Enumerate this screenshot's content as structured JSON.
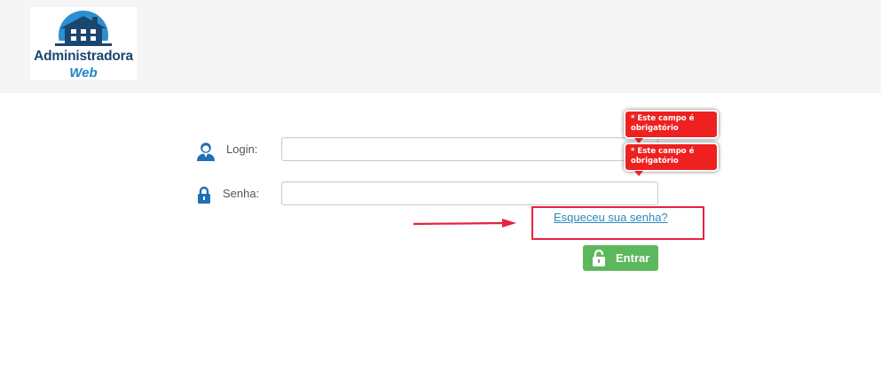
{
  "header": {
    "logo_line1": "Administradora",
    "logo_line2": "Web"
  },
  "form": {
    "login_label": "Login:",
    "login_value": "",
    "senha_label": "Senha:",
    "senha_value": "",
    "forgot_link": "Esqueceu sua senha?",
    "submit_label": "Entrar"
  },
  "validation": {
    "tooltips": [
      {
        "text": "* Este campo é obrigatório"
      },
      {
        "text": "* Este campo é obrigatório"
      }
    ]
  },
  "icons": {
    "login": "user-icon",
    "senha": "lock-icon",
    "submit": "unlock-icon",
    "annotation": "red-arrow-icon"
  },
  "colors": {
    "header_bg": "#f5f5f5",
    "brand_dark": "#1a4770",
    "brand_light": "#1e88c7",
    "error_red": "#ee2020",
    "annotation_red": "#e8213f",
    "link_blue": "#2a8bc0",
    "submit_green": "#5cb85c"
  }
}
